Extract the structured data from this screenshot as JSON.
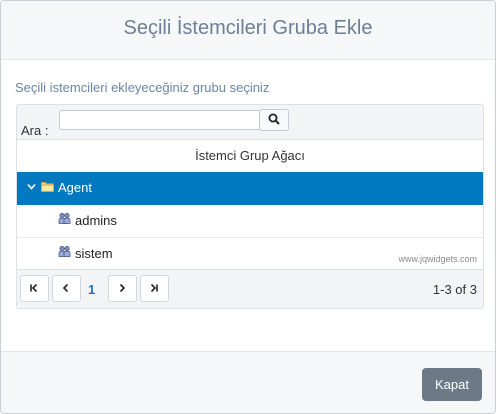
{
  "dialog": {
    "title": "Seçili İstemcileri Gruba Ekle",
    "instruction": "Seçili istemcileri ekleyeceğiniz grubu seçiniz"
  },
  "search": {
    "label": "Ara :",
    "value": "",
    "icon": "search-icon"
  },
  "tree": {
    "column_header": "İstemci Grup Ağacı",
    "items": [
      {
        "label": "Agent",
        "icon": "folder-icon",
        "expanded": true,
        "selected": true
      },
      {
        "label": "admins",
        "icon": "group-icon",
        "selected": false
      },
      {
        "label": "sistem",
        "icon": "group-icon",
        "selected": false
      }
    ],
    "watermark": "www.jqwidgets.com"
  },
  "pager": {
    "current_page": "1",
    "info": "1-3 of 3"
  },
  "footer": {
    "close_label": "Kapat"
  },
  "colors": {
    "selected_row": "#0079c1",
    "close_button": "#6c7986",
    "title_text": "#6f7f93",
    "instruction_text": "#6a85a6"
  }
}
